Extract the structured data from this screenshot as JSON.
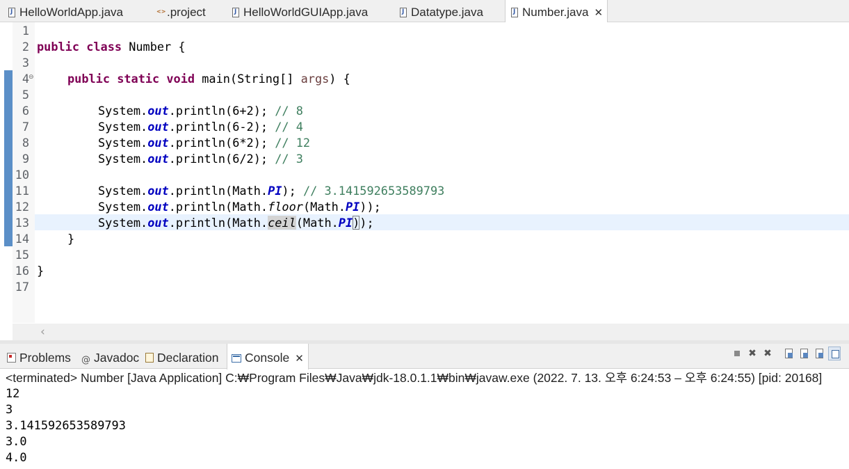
{
  "editor_tabs": [
    {
      "label": "HelloWorldApp.java",
      "icon": "java-file-icon",
      "active": false
    },
    {
      "label": ".project",
      "icon": "xml-file-icon",
      "active": false
    },
    {
      "label": "HelloWorldGUIApp.java",
      "icon": "java-file-icon",
      "active": false
    },
    {
      "label": "Datatype.java",
      "icon": "java-file-icon",
      "active": false
    },
    {
      "label": "Number.java",
      "icon": "java-file-icon",
      "active": true,
      "close": "✕"
    }
  ],
  "line_numbers": [
    "1",
    "2",
    "3",
    "4",
    "5",
    "6",
    "7",
    "8",
    "9",
    "10",
    "11",
    "12",
    "13",
    "14",
    "15",
    "16",
    "17"
  ],
  "code": {
    "l2": {
      "kw1": "public",
      "kw2": "class",
      "rest": " Number {"
    },
    "l4": {
      "kw1": "public",
      "kw2": "static",
      "kw3": "void",
      "mid": " main(String[] ",
      "param": "args",
      "end": ") {"
    },
    "l6": {
      "pre": "System.",
      "field": "out",
      "mid": ".println(6+2); ",
      "comment": "// 8"
    },
    "l7": {
      "pre": "System.",
      "field": "out",
      "mid": ".println(6-2); ",
      "comment": "// 4"
    },
    "l8": {
      "pre": "System.",
      "field": "out",
      "mid": ".println(6*2); ",
      "comment": "// 12"
    },
    "l9": {
      "pre": "System.",
      "field": "out",
      "mid": ".println(6/2); ",
      "comment": "// 3"
    },
    "l11": {
      "pre": "System.",
      "field": "out",
      "mid": ".println(Math.",
      "const": "PI",
      "end": "); ",
      "comment": "// 3.141592653589793"
    },
    "l12": {
      "pre": "System.",
      "field": "out",
      "mid": ".println(Math.",
      "method": "floor",
      "mid2": "(Math.",
      "const": "PI",
      "end": "));"
    },
    "l13": {
      "pre": "System.",
      "field": "out",
      "mid": ".println(Math.",
      "method": "ceil",
      "mid2": "(Math.",
      "const": "PI",
      "bracket": ")",
      "end": ");"
    },
    "l14": {
      "text": "}"
    },
    "l16": {
      "text": "}"
    }
  },
  "panel_tabs": [
    {
      "label": "Problems",
      "icon": "problems-icon"
    },
    {
      "label": "Javadoc",
      "icon": "javadoc-icon"
    },
    {
      "label": "Declaration",
      "icon": "declaration-icon"
    },
    {
      "label": "Console",
      "icon": "console-icon",
      "active": true,
      "close": "✕"
    }
  ],
  "console": {
    "header": "<terminated> Number [Java Application] C:₩Program Files₩Java₩jdk-18.0.1.1₩bin₩javaw.exe  (2022. 7. 13. 오후 6:24:53 – 오후 6:24:55) [pid: 20168]",
    "output": [
      "12",
      "3",
      "3.141592653589793",
      "3.0",
      "4.0"
    ]
  },
  "colors": {
    "keyword": "#7f0055",
    "static_field": "#0000c0",
    "comment": "#3f7f5f",
    "current_line": "#e8f2fe",
    "ruler": "#5b8fc7"
  }
}
